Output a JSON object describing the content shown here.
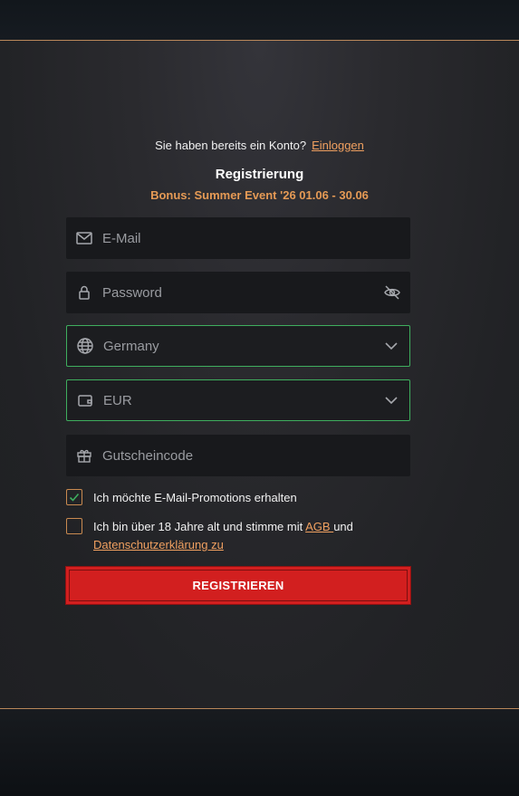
{
  "login": {
    "prompt": "Sie haben bereits ein Konto?",
    "link": "Einloggen"
  },
  "form": {
    "title": "Registrierung",
    "bonus": "Bonus: Summer Event '26 01.06 - 30.06",
    "email_placeholder": "E-Mail",
    "password_placeholder": "Password",
    "country_value": "Germany",
    "currency_value": "EUR",
    "voucher_placeholder": "Gutscheincode",
    "promo_checkbox": {
      "label": "Ich möchte E-Mail-Promotions erhalten",
      "checked": true
    },
    "terms_checkbox": {
      "text_before": "Ich bin über 18 Jahre alt und stimme mit ",
      "link_agb": "AGB ",
      "text_and": "und",
      "link_privacy": "Datenschutzerklärung zu",
      "checked": false
    },
    "submit_label": "REGISTRIEREN"
  },
  "colors": {
    "accent": "#e59a55",
    "link": "#f0a060",
    "valid_border": "#3fae5e",
    "button": "#d21f1f"
  },
  "icons": [
    "mail-icon",
    "lock-icon",
    "eye-off-icon",
    "globe-icon",
    "chevron-down-icon",
    "wallet-icon",
    "gift-icon",
    "check-icon"
  ]
}
